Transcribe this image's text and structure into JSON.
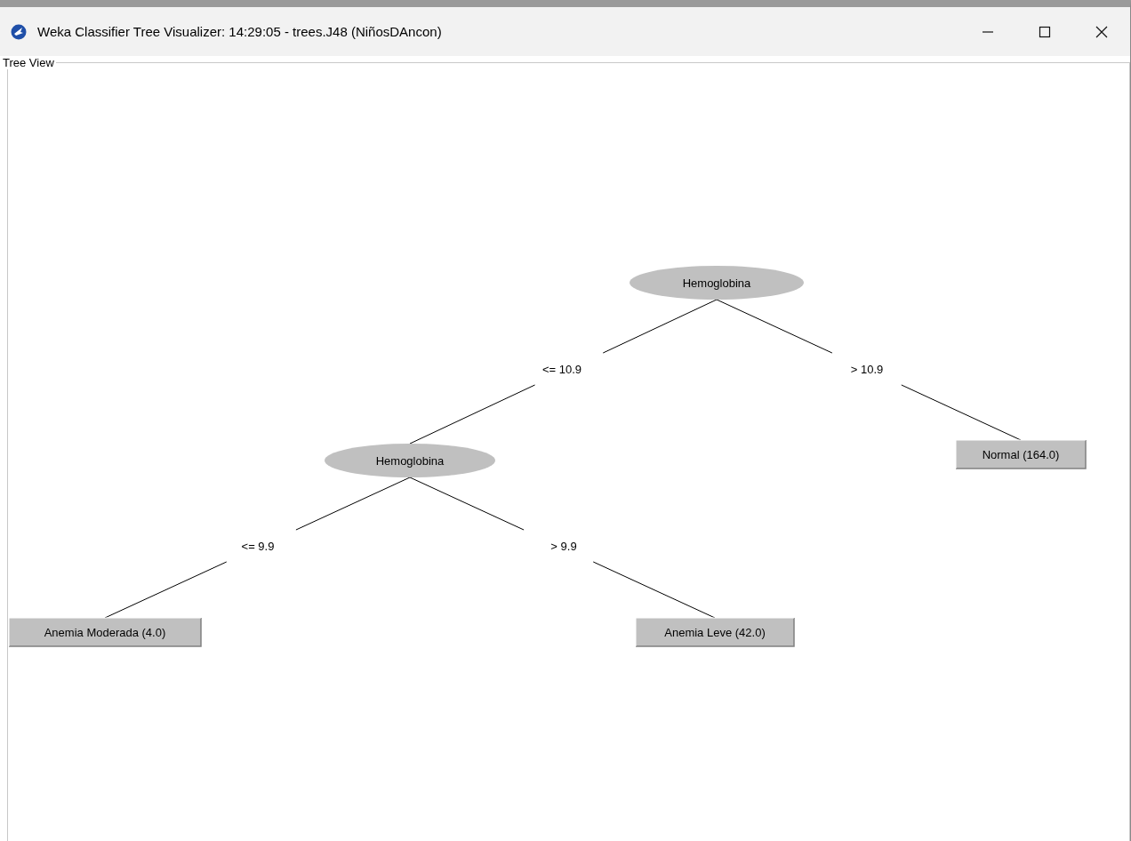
{
  "window": {
    "title": "Weka Classifier Tree Visualizer: 14:29:05 - trees.J48 (NiñosDAncon)"
  },
  "panel": {
    "title": "Tree View"
  },
  "tree": {
    "kind": "split",
    "label": "Hemoglobina",
    "children": [
      {
        "edge": "<= 10.9",
        "node": {
          "kind": "split",
          "label": "Hemoglobina",
          "children": [
            {
              "edge": "<= 9.9",
              "node": {
                "kind": "leaf",
                "label": "Anemia Moderada (4.0)"
              }
            },
            {
              "edge": "> 9.9",
              "node": {
                "kind": "leaf",
                "label": "Anemia Leve (42.0)"
              }
            }
          ]
        }
      },
      {
        "edge": "> 10.9",
        "node": {
          "kind": "leaf",
          "label": "Normal (164.0)"
        }
      }
    ]
  }
}
